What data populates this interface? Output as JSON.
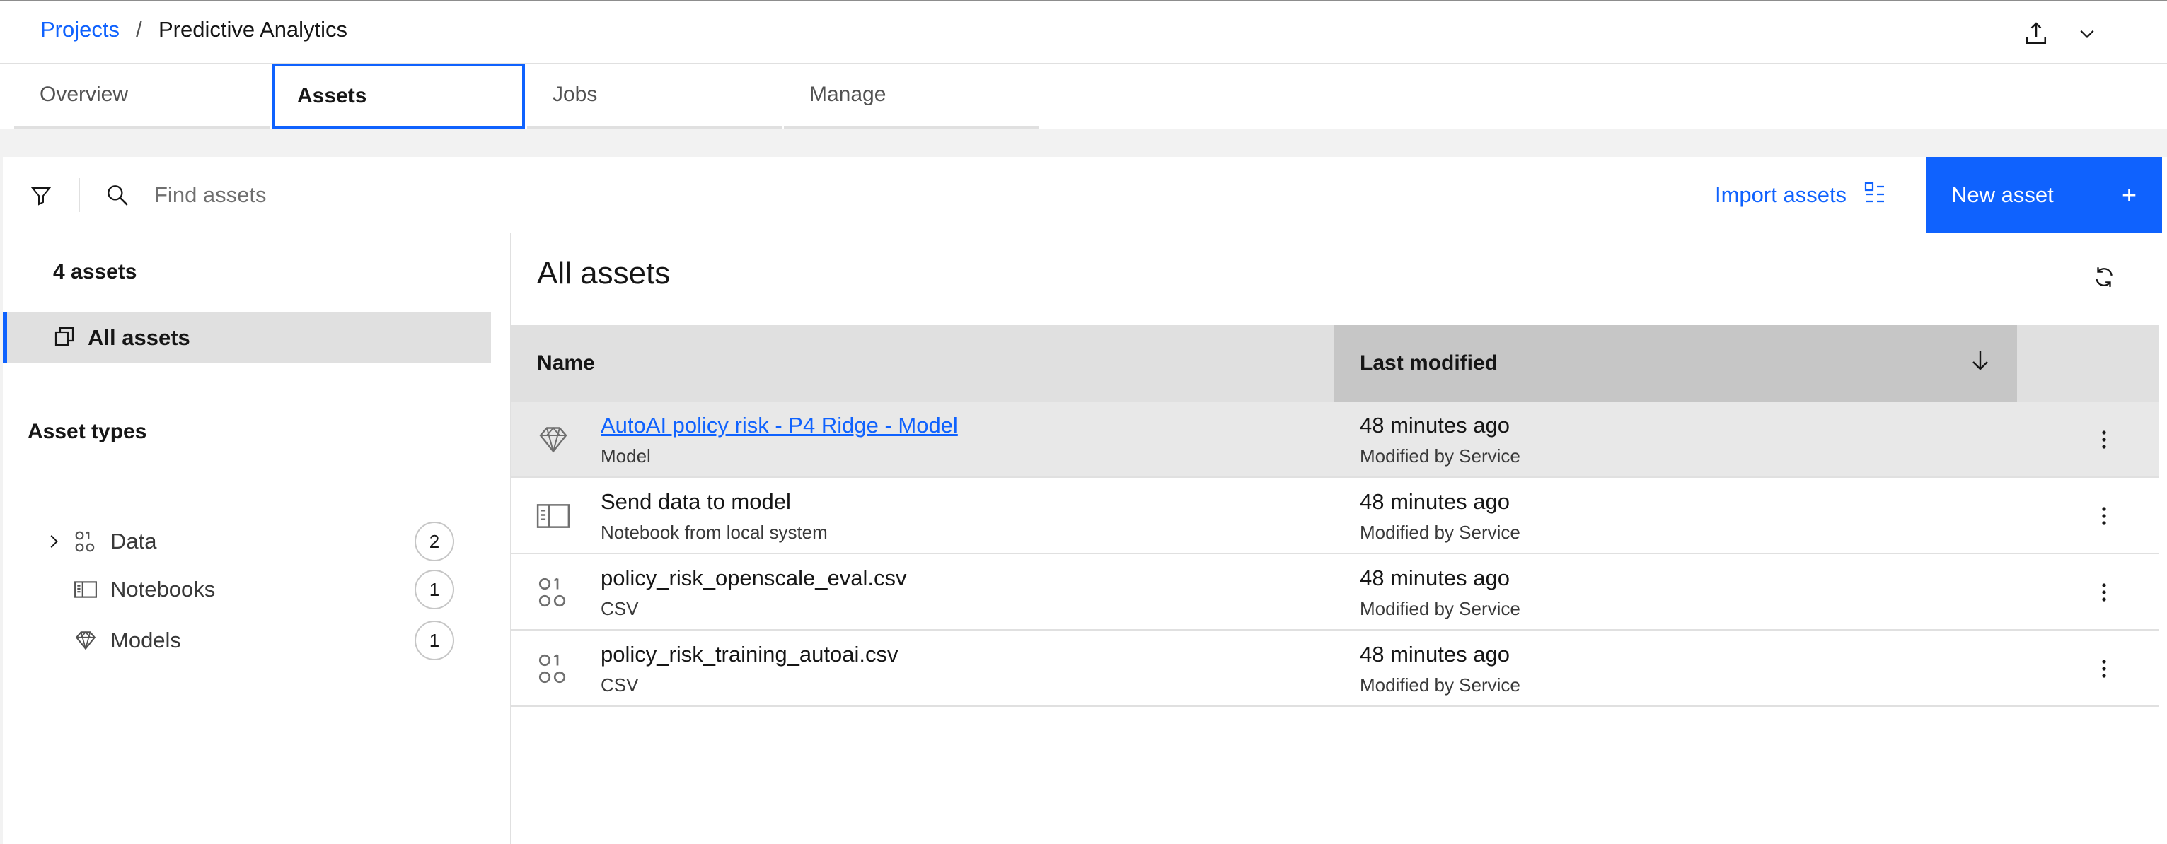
{
  "breadcrumb": {
    "root": "Projects",
    "separator": "/",
    "current": "Predictive Analytics"
  },
  "header_icons": [
    "download-icon",
    "chevron-down-icon"
  ],
  "tabs": [
    {
      "label": "Overview",
      "selected": false
    },
    {
      "label": "Assets",
      "selected": true
    },
    {
      "label": "Jobs",
      "selected": false
    },
    {
      "label": "Manage",
      "selected": false
    }
  ],
  "toolbar": {
    "search_placeholder": "Find assets",
    "import_label": "Import assets",
    "new_label": "New asset",
    "new_icon": "+"
  },
  "sidebar": {
    "count_label": "4 assets",
    "all_assets_label": "All assets",
    "types_heading": "Asset types",
    "types": [
      {
        "label": "Data",
        "count": "2",
        "icon": "data-icon",
        "expandable": true
      },
      {
        "label": "Notebooks",
        "count": "1",
        "icon": "notebook-icon",
        "expandable": false
      },
      {
        "label": "Models",
        "count": "1",
        "icon": "model-icon",
        "expandable": false
      }
    ]
  },
  "main": {
    "title": "All assets",
    "columns": {
      "name": "Name",
      "modified": "Last modified"
    },
    "rows": [
      {
        "name": "AutoAI policy risk - P4 Ridge - Model",
        "type": "Model",
        "modified": "48 minutes ago",
        "modified_by": "Modified by Service",
        "icon": "model-icon"
      },
      {
        "name": "Send data to model",
        "type": "Notebook from local system",
        "modified": "48 minutes ago",
        "modified_by": "Modified by Service",
        "icon": "notebook-icon"
      },
      {
        "name": "policy_risk_openscale_eval.csv",
        "type": "CSV",
        "modified": "48 minutes ago",
        "modified_by": "Modified by Service",
        "icon": "data-icon"
      },
      {
        "name": "policy_risk_training_autoai.csv",
        "type": "CSV",
        "modified": "48 minutes ago",
        "modified_by": "Modified by Service",
        "icon": "data-icon"
      }
    ]
  },
  "colors": {
    "accent": "#0f62fe",
    "selected_row": "#e0e0e0",
    "sorted_header": "#c6c6c6"
  }
}
